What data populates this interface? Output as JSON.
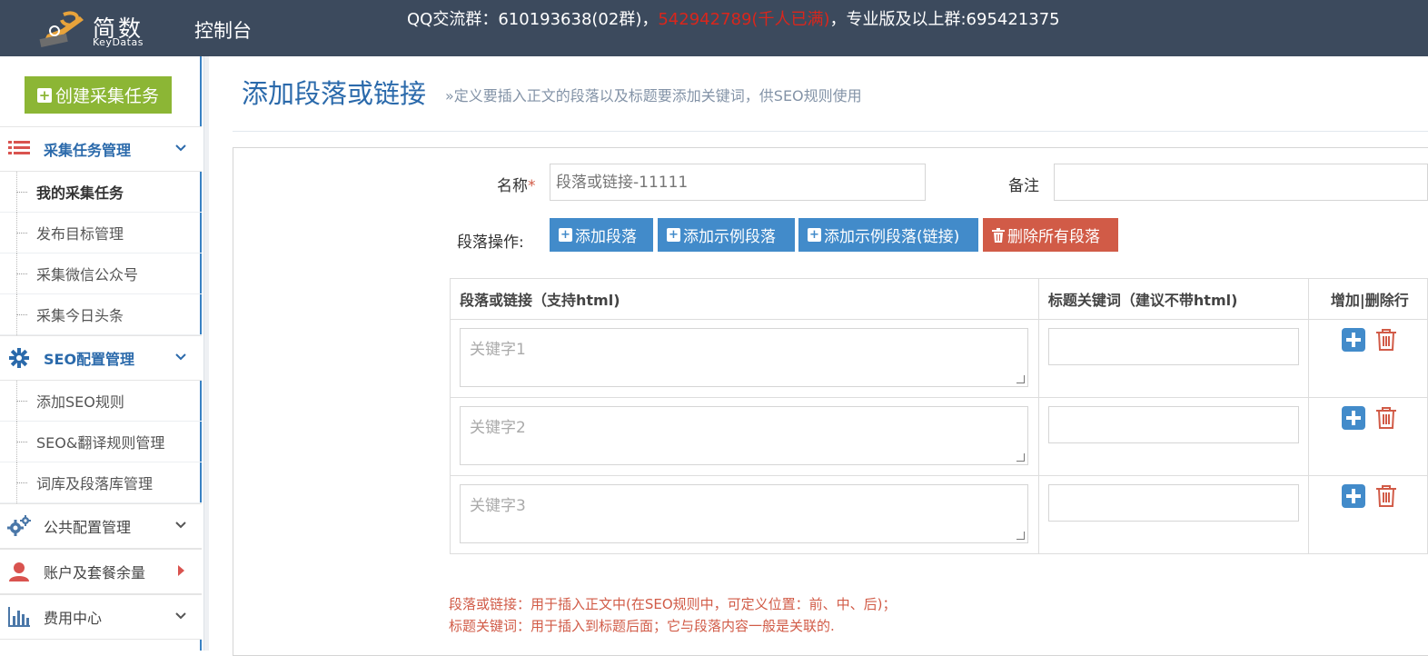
{
  "header": {
    "logo_cn": "简数",
    "logo_en": "KeyDatas",
    "title": "控制台",
    "qq_prefix": "QQ交流群：610193638(02群)，",
    "qq_full": "542942789(千人已满)",
    "qq_suffix": "，专业版及以上群:695421375"
  },
  "sidebar": {
    "create_button": "创建采集任务",
    "sections": [
      {
        "label": "采集任务管理",
        "icon": "list-icon",
        "items": [
          "我的采集任务",
          "发布目标管理",
          "采集微信公众号",
          "采集今日头条"
        ]
      },
      {
        "label": "SEO配置管理",
        "icon": "gear-icon",
        "items": [
          "添加SEO规则",
          "SEO&翻译规则管理",
          "词库及段落库管理"
        ]
      },
      {
        "label": "公共配置管理",
        "icon": "gears-icon",
        "items": []
      },
      {
        "label": "账户及套餐余量",
        "icon": "user-icon",
        "items": []
      },
      {
        "label": "费用中心",
        "icon": "bar-chart-icon",
        "items": []
      }
    ]
  },
  "main": {
    "title": "添加段落或链接",
    "subtitle": "»定义要插入正文的段落以及标题要添加关键词，供SEO规则使用",
    "form": {
      "name_label": "名称",
      "name_required": "*",
      "name_placeholder": "段落或链接-11111",
      "remark_label": "备注",
      "remark_value": "",
      "ops_label": "段落操作:",
      "buttons": [
        "添加段落",
        "添加示例段落",
        "添加示例段落(链接)",
        "删除所有段落"
      ]
    },
    "table": {
      "headers": [
        "段落或链接（支持html)",
        "标题关键词（建议不带html)",
        "增加|删除行"
      ],
      "rows": [
        {
          "paragraph_placeholder": "关键字1",
          "keyword": ""
        },
        {
          "paragraph_placeholder": "关键字2",
          "keyword": ""
        },
        {
          "paragraph_placeholder": "关键字3",
          "keyword": ""
        }
      ]
    },
    "notes": [
      "段落或链接：用于插入正文中(在SEO规则中，可定义位置：前、中、后)；",
      "标题关键词：用于插入到标题后面；它与段落内容一般是关联的."
    ]
  },
  "colors": {
    "topbar": "#3c4a5d",
    "accent_blue": "#428bca",
    "danger_red": "#d15b47",
    "create_green": "#8cb635",
    "qq_red": "#d9261c"
  }
}
